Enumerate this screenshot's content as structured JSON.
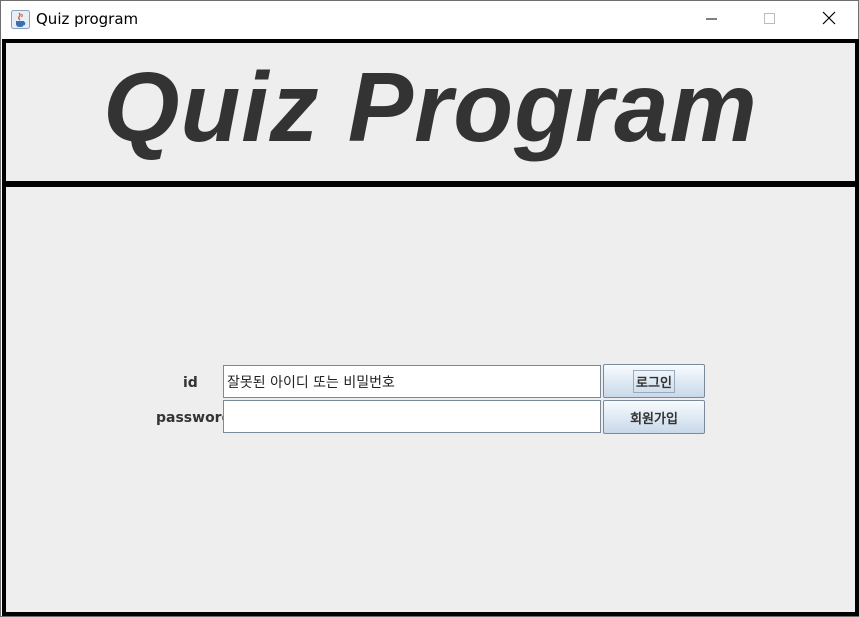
{
  "window": {
    "title": "Quiz program",
    "icons": {
      "app": "java-cup-icon",
      "minimize": "minimize-icon",
      "maximize": "maximize-icon",
      "close": "close-icon"
    }
  },
  "header": {
    "title": "Quiz Program"
  },
  "login_form": {
    "id_label": "id",
    "id_value": "잘못된 아이디 또는 비밀번호",
    "password_label": "password",
    "password_value": "",
    "login_button": "로그인",
    "signup_button": "회원가입"
  },
  "colors": {
    "panel_bg": "#eeeeee",
    "border": "#000000",
    "title_text": "#333333"
  }
}
